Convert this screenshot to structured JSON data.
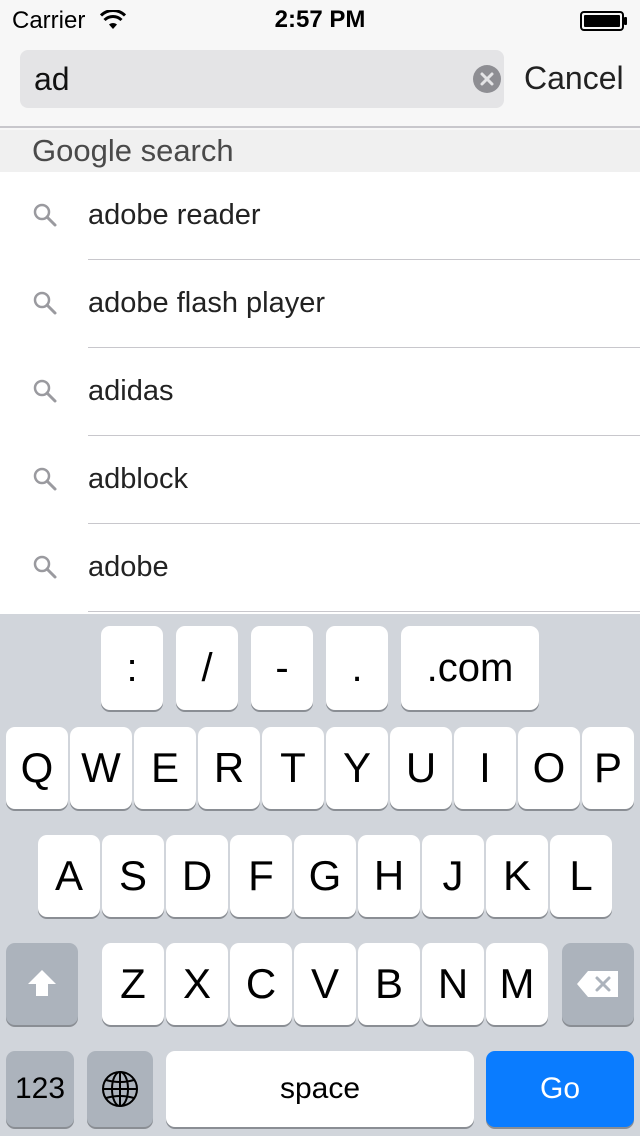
{
  "status_bar": {
    "carrier": "Carrier",
    "time": "2:57 PM"
  },
  "search": {
    "value": "ad",
    "cancel_label": "Cancel"
  },
  "suggestions": {
    "section_title": "Google search",
    "items": [
      {
        "label": "adobe reader",
        "icon": "search-icon"
      },
      {
        "label": "adobe flash player",
        "icon": "search-icon"
      },
      {
        "label": "adidas",
        "icon": "search-icon"
      },
      {
        "label": "adblock",
        "icon": "search-icon"
      },
      {
        "label": "adobe",
        "icon": "search-icon"
      }
    ]
  },
  "keyboard": {
    "top_row": [
      ":",
      "/",
      "-",
      ".",
      ".com"
    ],
    "row1": [
      "Q",
      "W",
      "E",
      "R",
      "T",
      "Y",
      "U",
      "I",
      "O",
      "P"
    ],
    "row2": [
      "A",
      "S",
      "D",
      "F",
      "G",
      "H",
      "J",
      "K",
      "L"
    ],
    "row3": [
      "Z",
      "X",
      "C",
      "V",
      "B",
      "N",
      "M"
    ],
    "numbers_label": "123",
    "space_label": "space",
    "go_label": "Go",
    "icons": {
      "shift": "shift-icon",
      "delete": "backspace-icon",
      "globe": "globe-icon"
    }
  },
  "colors": {
    "accent": "#0a7cff",
    "keyboard_bg": "#d1d5db",
    "dark_key": "#acb3bc"
  }
}
